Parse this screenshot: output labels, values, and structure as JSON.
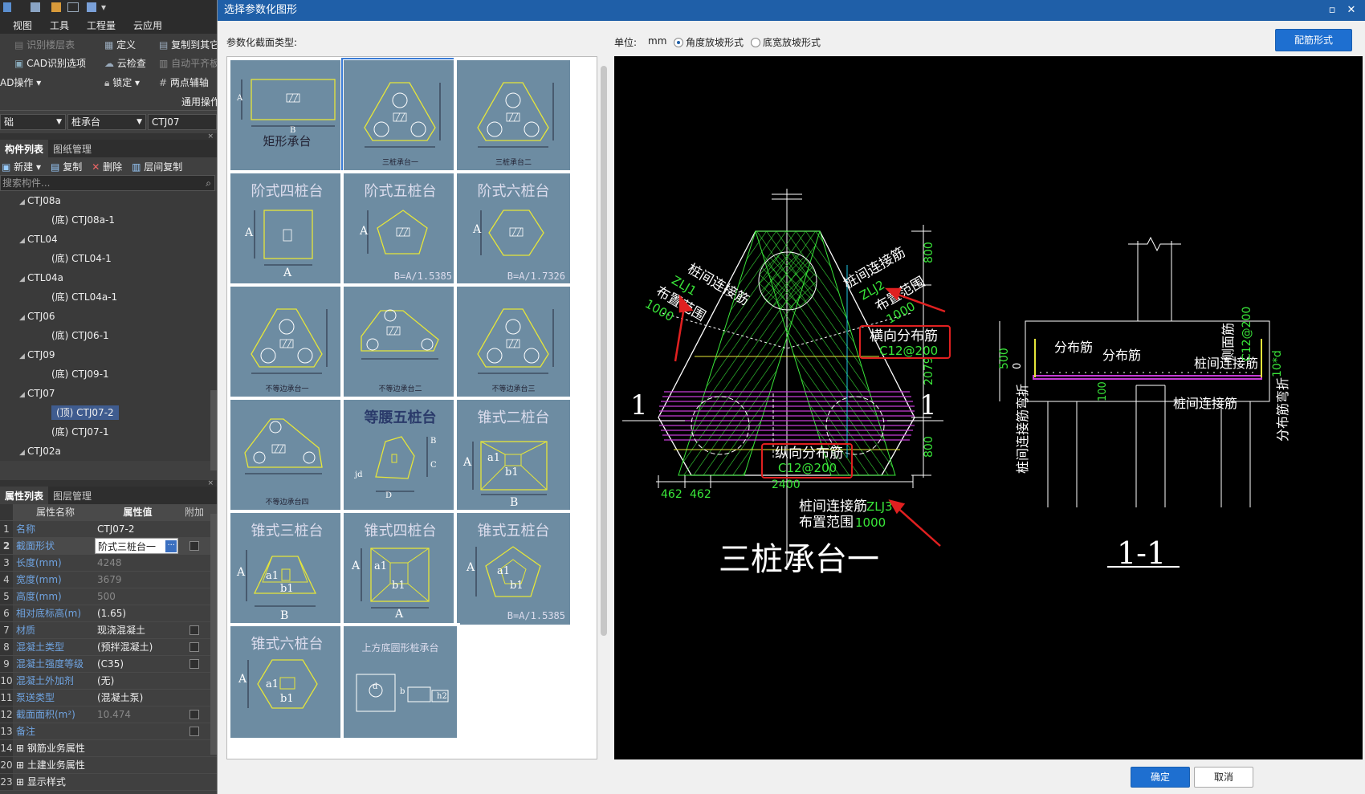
{
  "left": {
    "menu_tabs": [
      "视图",
      "工具",
      "工程量",
      "云应用"
    ],
    "ribbon": {
      "b1": "识别楼层表",
      "b2": "CAD识别选项",
      "b3": "AD操作",
      "b4": "定义",
      "b5": "云检查",
      "b6": "锁定",
      "b7": "复制到其它",
      "b8": "自动平齐板",
      "b9": "两点辅轴",
      "b10": "通用操作"
    },
    "combo1": "础",
    "combo2": "桩承台",
    "combo3": "CTJ07",
    "panel_tabs": [
      "构件列表",
      "图纸管理"
    ],
    "tools": [
      "新建",
      "复制",
      "删除",
      "层间复制"
    ],
    "search_placeholder": "搜索构件...",
    "tree": [
      {
        "label": "CTJ08a",
        "level": 0
      },
      {
        "label": "(底) CTJ08a-1",
        "level": 1
      },
      {
        "label": "CTL04",
        "level": 0
      },
      {
        "label": "(底) CTL04-1",
        "level": 1
      },
      {
        "label": "CTL04a",
        "level": 0
      },
      {
        "label": "(底) CTL04a-1",
        "level": 1
      },
      {
        "label": "CTJ06",
        "level": 0
      },
      {
        "label": "(底) CTJ06-1",
        "level": 1
      },
      {
        "label": "CTJ09",
        "level": 0
      },
      {
        "label": "(底) CTJ09-1",
        "level": 1
      },
      {
        "label": "CTJ07",
        "level": 0
      },
      {
        "label": "(顶) CTJ07-2",
        "level": 1,
        "selected": true
      },
      {
        "label": "(底) CTJ07-1",
        "level": 1
      },
      {
        "label": "CTJ02a",
        "level": 0
      }
    ],
    "prop_tabs": [
      "属性列表",
      "图层管理"
    ],
    "prop_headers": [
      "属性名称",
      "属性值",
      "附加"
    ],
    "props": [
      {
        "n": "1",
        "k": "名称",
        "v": "CTJ07-2",
        "g": false,
        "cb": false
      },
      {
        "n": "2",
        "k": "截面形状",
        "v": "阶式三桩台一",
        "g": false,
        "cb": true,
        "edit": true
      },
      {
        "n": "3",
        "k": "长度(mm)",
        "v": "4248",
        "g": true,
        "cb": false
      },
      {
        "n": "4",
        "k": "宽度(mm)",
        "v": "3679",
        "g": true,
        "cb": false
      },
      {
        "n": "5",
        "k": "高度(mm)",
        "v": "500",
        "g": true,
        "cb": false
      },
      {
        "n": "6",
        "k": "相对底标高(m)",
        "v": "(1.65)",
        "g": false,
        "cb": false
      },
      {
        "n": "7",
        "k": "材质",
        "v": "现浇混凝土",
        "g": false,
        "cb": true
      },
      {
        "n": "8",
        "k": "混凝土类型",
        "v": "(预拌混凝土)",
        "g": false,
        "cb": true
      },
      {
        "n": "9",
        "k": "混凝土强度等级",
        "v": "(C35)",
        "g": false,
        "cb": true
      },
      {
        "n": "10",
        "k": "混凝土外加剂",
        "v": "(无)",
        "g": false,
        "cb": false
      },
      {
        "n": "11",
        "k": "泵送类型",
        "v": "(混凝土泵)",
        "g": false,
        "cb": false
      },
      {
        "n": "12",
        "k": "截面面积(m²)",
        "v": "10.474",
        "g": true,
        "cb": true
      },
      {
        "n": "13",
        "k": "备注",
        "v": "",
        "g": false,
        "cb": true
      },
      {
        "n": "14",
        "k": "钢筋业务属性",
        "v": "",
        "g": false,
        "cb": false,
        "grp": true
      },
      {
        "n": "20",
        "k": "土建业务属性",
        "v": "",
        "g": false,
        "cb": false,
        "grp": true
      },
      {
        "n": "23",
        "k": "显示样式",
        "v": "",
        "g": false,
        "cb": false,
        "grp": true
      }
    ]
  },
  "dialog": {
    "title": "选择参数化图形",
    "type_label": "参数化截面类型:",
    "unit_label": "单位:",
    "unit": "mm",
    "radio1": "角度放坡形式",
    "radio2": "底宽放坡形式",
    "rebar_button": "配筋形式",
    "ok": "确定",
    "cancel": "取消",
    "gallery": {
      "c0": {
        "title": "矩形承台",
        "a": "A",
        "b": "B"
      },
      "c1": {
        "label": "三桩承台一"
      },
      "c2": {
        "label": "三桩承台二"
      },
      "c3": {
        "title": "阶式四桩台",
        "a": "A",
        "b": "A"
      },
      "c4": {
        "title": "阶式五桩台",
        "a": "A",
        "formula": "B=A/1.5385"
      },
      "c5": {
        "title": "阶式六桩台",
        "a": "A",
        "formula": "B=A/1.7326"
      },
      "c6": {
        "label": "不等边承台一"
      },
      "c7": {
        "label": "不等边承台二"
      },
      "c8": {
        "label": "不等边承台三"
      },
      "c9": {
        "label": "不等边承台四"
      },
      "c10": {
        "title": "等腰五桩台",
        "b": "B",
        "c": "C",
        "d": "D",
        "jd": "jd"
      },
      "c11": {
        "title": "锥式二桩台",
        "a": "A",
        "a1": "a1",
        "b1": "b1",
        "b": "B"
      },
      "c12": {
        "title": "锥式三桩台",
        "a": "A",
        "a1": "a1",
        "b1": "b1",
        "b": "B"
      },
      "c13": {
        "title": "锥式四桩台",
        "a": "A",
        "a1": "a1",
        "b1": "b1",
        "b": "A"
      },
      "c14": {
        "title": "锥式五桩台",
        "a": "A",
        "a1": "a1",
        "b1": "b1",
        "formula": "B=A/1.5385"
      },
      "c15": {
        "title": "锥式六桩台",
        "a": "A",
        "a1": "a1",
        "b1": "b1"
      },
      "c16": {
        "title": "上方底圆形桩承台",
        "d": "d",
        "b": "b",
        "h2": "h2"
      }
    },
    "cad": {
      "zlj1": "桩间连接筋",
      "zlj1_code": "ZLJ1",
      "zlj1_range": "布置范围",
      "zlj1_val": "1000",
      "zlj2": "桩间连接筋",
      "zlj2_code": "ZLJ2",
      "zlj2_range": "布置范围",
      "zlj2_val": "1000",
      "heng": "横向分布筋",
      "heng_code": "C12@200",
      "zong": "纵向分布筋",
      "zong_code": "C12@200",
      "zlj3": "桩间连接筋",
      "zlj3_code": "ZLJ3",
      "zlj3_range": "布置范围",
      "zlj3_val": "1000",
      "d800a": "800",
      "d2079": "2079",
      "d800b": "800",
      "d462a": "462",
      "d462b": "462",
      "d2400": "2400",
      "sec1": "1",
      "sec1b": "1",
      "name": "三桩承台一",
      "sec": {
        "fb1": "分布筋",
        "fb2": "分布筋",
        "zlj": "桩间连接筋",
        "zlj_b": "桩间连接筋",
        "cmj": "侧面筋",
        "cmj_code": "C12@200",
        "d500": "500",
        "d0": "0",
        "d100": "100",
        "ten": "10*d",
        "left_v": "桩间连接筋弯折",
        "right_v": "分布筋弯折",
        "title": "1-1"
      }
    }
  }
}
